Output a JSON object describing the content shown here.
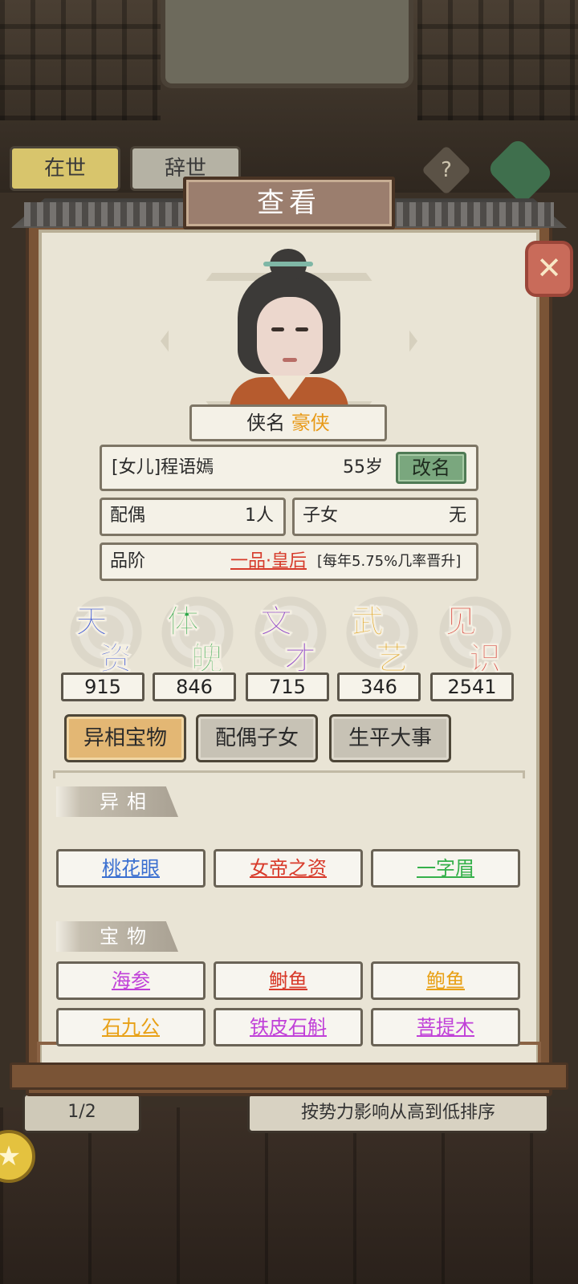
{
  "background": {
    "tabs": [
      "在世",
      "辞世"
    ],
    "help_symbol": "?",
    "pager": "1/2",
    "sort_label": "按势力影响从高到低排序"
  },
  "modal": {
    "title": "查看",
    "close_icon": "close-icon"
  },
  "character": {
    "title_label": "侠名",
    "title_value": "豪侠",
    "name": "[女儿]程语嫣",
    "age": "55岁",
    "rename_label": "改名",
    "spouse_label": "配偶",
    "spouse_value": "1人",
    "children_label": "子女",
    "children_value": "无",
    "rank_label": "品阶",
    "rank_value": "一品·皇后",
    "rank_note": "[每年5.75%几率晋升]"
  },
  "stats": [
    {
      "name": "天资",
      "value": "915",
      "color": "#3a56d8"
    },
    {
      "name": "体魄",
      "value": "846",
      "color": "#2fa84a"
    },
    {
      "name": "文才",
      "value": "715",
      "color": "#8b3fc8"
    },
    {
      "name": "武艺",
      "value": "346",
      "color": "#e0a21a"
    },
    {
      "name": "见识",
      "value": "2541",
      "color": "#d8413a"
    }
  ],
  "tabs": [
    {
      "label": "异相宝物",
      "active": true
    },
    {
      "label": "配偶子女",
      "active": false
    },
    {
      "label": "生平大事",
      "active": false
    }
  ],
  "sections": {
    "traits_title": "异相",
    "treasures_title": "宝物"
  },
  "traits": [
    {
      "label": "桃花眼",
      "color": "#3a6fd0"
    },
    {
      "label": "女帝之资",
      "color": "#d83a2a"
    },
    {
      "label": "一字眉",
      "color": "#35b04a"
    }
  ],
  "treasures": [
    {
      "label": "海参",
      "color": "#c040d8"
    },
    {
      "label": "鲥鱼",
      "color": "#d83a2a"
    },
    {
      "label": "鲍鱼",
      "color": "#e8a015"
    },
    {
      "label": "石九公",
      "color": "#e8a015"
    },
    {
      "label": "铁皮石斛",
      "color": "#c040d8"
    },
    {
      "label": "菩提木",
      "color": "#c040d8"
    }
  ]
}
